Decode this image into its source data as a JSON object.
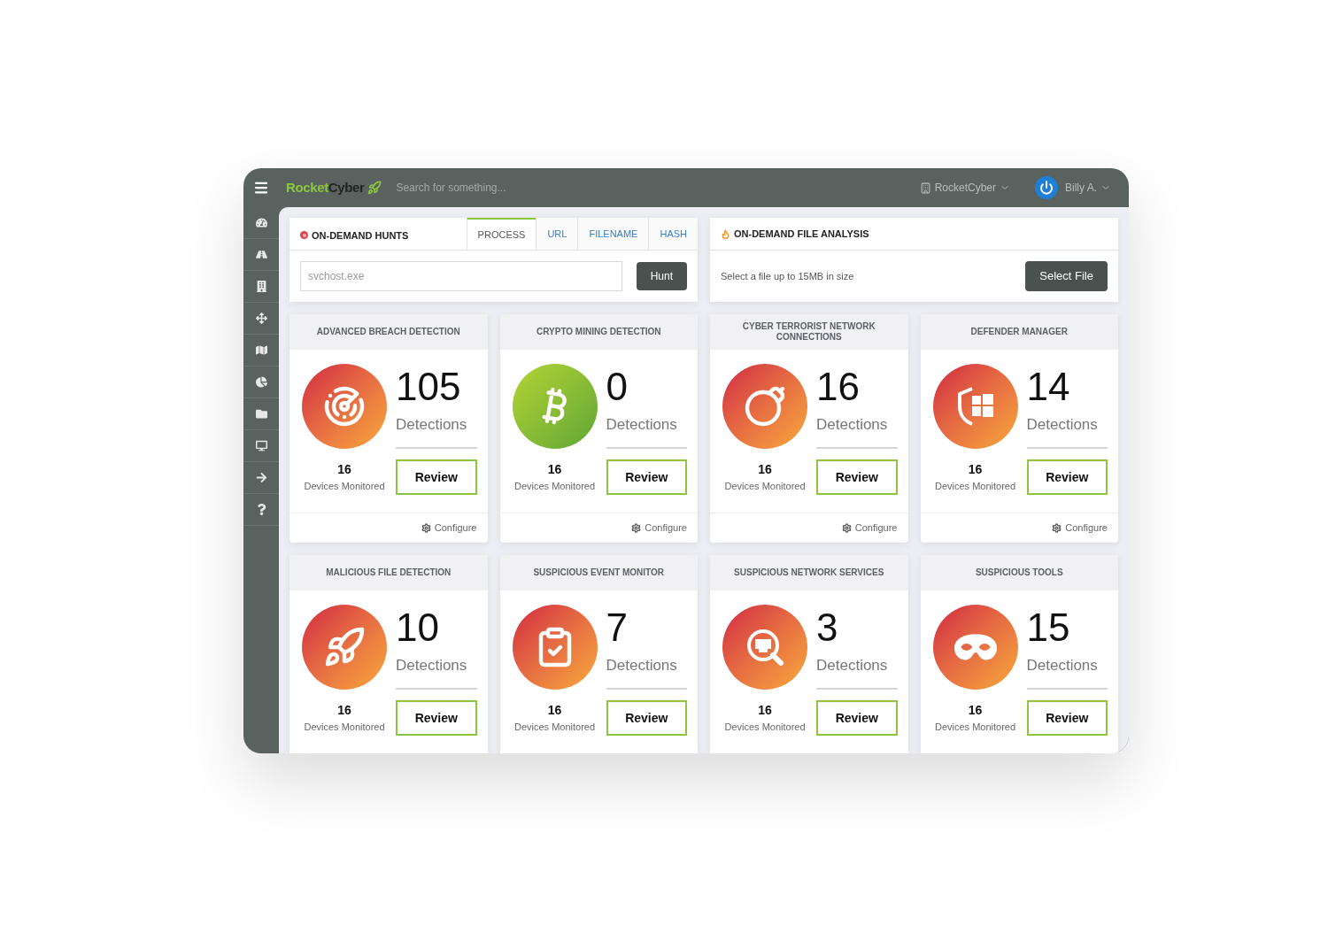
{
  "topbar": {
    "logo": {
      "primary": "Rocket",
      "secondary": "Cyber"
    },
    "search": {
      "placeholder": "Search for something..."
    },
    "organization": "RocketCyber",
    "user": "Billy A."
  },
  "sidebar": {
    "items": [
      {
        "kind": "gauge"
      },
      {
        "kind": "road"
      },
      {
        "kind": "building"
      },
      {
        "kind": "move"
      },
      {
        "kind": "map"
      },
      {
        "kind": "pie"
      },
      {
        "kind": "folder"
      },
      {
        "kind": "monitor"
      },
      {
        "kind": "arrow"
      },
      {
        "kind": "help"
      }
    ]
  },
  "hunts": {
    "title": "ON-DEMAND HUNTS",
    "tabs": [
      {
        "label": "PROCESS",
        "selected": true
      },
      {
        "label": "URL",
        "selected": false
      },
      {
        "label": "FILENAME",
        "selected": false
      },
      {
        "label": "HASH",
        "selected": false
      }
    ],
    "input": {
      "placeholder": "svchost.exe"
    },
    "button": "Hunt"
  },
  "file_analysis": {
    "title": "ON-DEMAND FILE ANALYSIS",
    "description": "Select a file up to 15MB in size",
    "button": "Select File"
  },
  "cards": [
    {
      "title": "ADVANCED BREACH DETECTION",
      "kind": "radar",
      "count": "105",
      "count_label": "Detections",
      "devices": "16",
      "devices_label": "Devices Monitored",
      "button": "Review",
      "configure": "Configure"
    },
    {
      "title": "CRYPTO MINING DETECTION",
      "kind": "bitcoin",
      "count": "0",
      "count_label": "Detections",
      "devices": "16",
      "devices_label": "Devices Monitored",
      "button": "Review",
      "configure": "Configure"
    },
    {
      "title": "CYBER TERRORIST NETWORK CONNECTIONS",
      "kind": "bomb",
      "count": "16",
      "count_label": "Detections",
      "devices": "16",
      "devices_label": "Devices Monitored",
      "button": "Review",
      "configure": "Configure"
    },
    {
      "title": "DEFENDER MANAGER",
      "kind": "shield",
      "count": "14",
      "count_label": "Detections",
      "devices": "16",
      "devices_label": "Devices Monitored",
      "button": "Review",
      "configure": "Configure"
    },
    {
      "title": "MALICIOUS FILE DETECTION",
      "kind": "rocket",
      "count": "10",
      "count_label": "Detections",
      "devices": "16",
      "devices_label": "Devices Monitored",
      "button": "Review"
    },
    {
      "title": "SUSPICIOUS EVENT MONITOR",
      "kind": "clipboard",
      "count": "7",
      "count_label": "Detections",
      "devices": "16",
      "devices_label": "Devices Monitored",
      "button": "Review"
    },
    {
      "title": "SUSPICIOUS NETWORK SERVICES",
      "kind": "network",
      "count": "3",
      "count_label": "Detections",
      "devices": "16",
      "devices_label": "Devices Monitored",
      "button": "Review"
    },
    {
      "title": "SUSPICIOUS TOOLS",
      "kind": "mask",
      "count": "15",
      "count_label": "Detections",
      "devices": "16",
      "devices_label": "Devices Monitored",
      "button": "Review"
    }
  ]
}
